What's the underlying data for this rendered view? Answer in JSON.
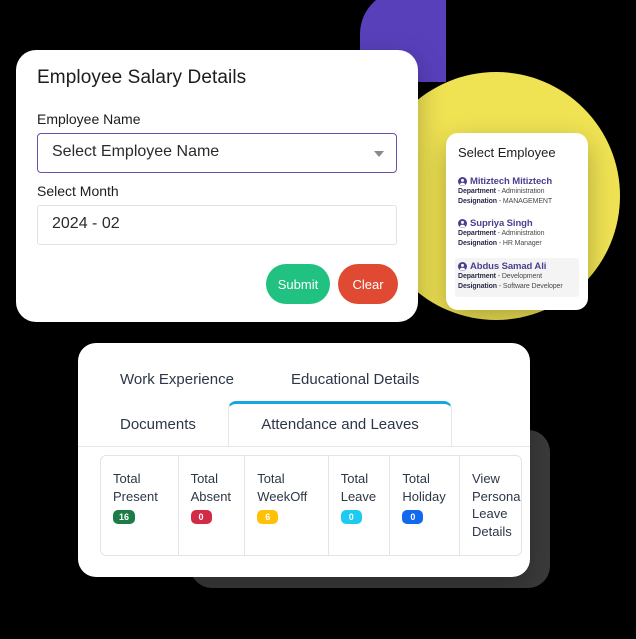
{
  "theme": {
    "background": "#000000",
    "purple_shape": "#5840bb",
    "yellow_circle": "#f0e353",
    "dark_card": "#3b3b3b",
    "select_border": "#6b4fb3",
    "active_tab_accent": "#18a6e0"
  },
  "salary_card": {
    "title": "Employee Salary Details",
    "employee_name_label": "Employee Name",
    "employee_select_value": "Select Employee Name",
    "select_month_label": "Select Month",
    "month_value": "2024 - 02",
    "submit_label": "Submit",
    "submit_color": "#21c281",
    "clear_label": "Clear",
    "clear_color": "#e04a32"
  },
  "employee_panel": {
    "title": "Select Employee",
    "department_key": "Department",
    "designation_key": "Designation",
    "separator": " - ",
    "items": [
      {
        "name": "Mitiztech Mitiztech",
        "department": "Administration",
        "designation": "MANAGEMENT",
        "selected": false
      },
      {
        "name": "Supriya Singh",
        "department": "Administration",
        "designation": "HR Manager",
        "selected": false
      },
      {
        "name": "Abdus Samad Ali",
        "department": "Development",
        "designation": "Software Developer",
        "selected": true
      }
    ]
  },
  "attendance_card": {
    "tabs": [
      {
        "label": "Work Experience",
        "active": false
      },
      {
        "label": "Educational Details",
        "active": false
      },
      {
        "label": "Documents",
        "active": false
      },
      {
        "label": "Attendance and Leaves",
        "active": true
      }
    ],
    "stats": [
      {
        "label": "Total Present",
        "value": "16",
        "color": "#1c7c45"
      },
      {
        "label": "Total Absent",
        "value": "0",
        "color": "#d32a45"
      },
      {
        "label": "Total WeekOff",
        "value": "6",
        "color": "#ffc107"
      },
      {
        "label": "Total Leave",
        "value": "0",
        "color": "#1ecbf0"
      },
      {
        "label": "Total Holiday",
        "value": "0",
        "color": "#1069ee"
      }
    ],
    "view_personal_leave_details": "View Personal Leave Details"
  }
}
